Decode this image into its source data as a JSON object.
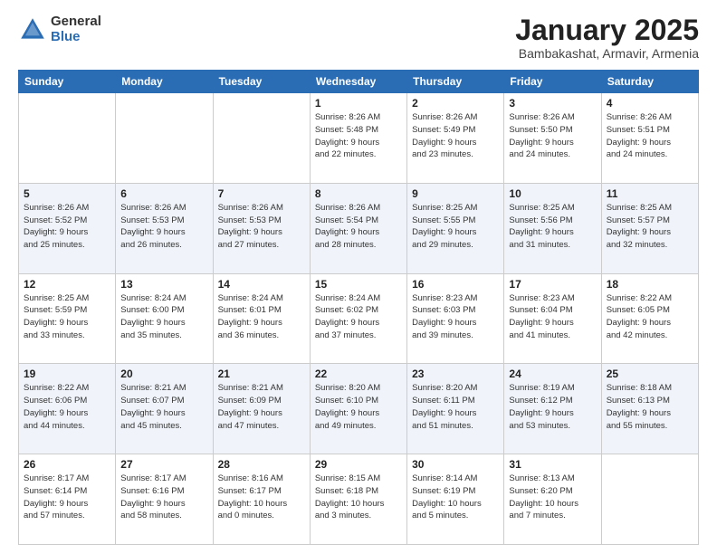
{
  "header": {
    "logo_general": "General",
    "logo_blue": "Blue",
    "month_title": "January 2025",
    "location": "Bambakashat, Armavir, Armenia"
  },
  "days_of_week": [
    "Sunday",
    "Monday",
    "Tuesday",
    "Wednesday",
    "Thursday",
    "Friday",
    "Saturday"
  ],
  "weeks": [
    [
      {
        "day": "",
        "info": ""
      },
      {
        "day": "",
        "info": ""
      },
      {
        "day": "",
        "info": ""
      },
      {
        "day": "1",
        "info": "Sunrise: 8:26 AM\nSunset: 5:48 PM\nDaylight: 9 hours\nand 22 minutes."
      },
      {
        "day": "2",
        "info": "Sunrise: 8:26 AM\nSunset: 5:49 PM\nDaylight: 9 hours\nand 23 minutes."
      },
      {
        "day": "3",
        "info": "Sunrise: 8:26 AM\nSunset: 5:50 PM\nDaylight: 9 hours\nand 24 minutes."
      },
      {
        "day": "4",
        "info": "Sunrise: 8:26 AM\nSunset: 5:51 PM\nDaylight: 9 hours\nand 24 minutes."
      }
    ],
    [
      {
        "day": "5",
        "info": "Sunrise: 8:26 AM\nSunset: 5:52 PM\nDaylight: 9 hours\nand 25 minutes."
      },
      {
        "day": "6",
        "info": "Sunrise: 8:26 AM\nSunset: 5:53 PM\nDaylight: 9 hours\nand 26 minutes."
      },
      {
        "day": "7",
        "info": "Sunrise: 8:26 AM\nSunset: 5:53 PM\nDaylight: 9 hours\nand 27 minutes."
      },
      {
        "day": "8",
        "info": "Sunrise: 8:26 AM\nSunset: 5:54 PM\nDaylight: 9 hours\nand 28 minutes."
      },
      {
        "day": "9",
        "info": "Sunrise: 8:25 AM\nSunset: 5:55 PM\nDaylight: 9 hours\nand 29 minutes."
      },
      {
        "day": "10",
        "info": "Sunrise: 8:25 AM\nSunset: 5:56 PM\nDaylight: 9 hours\nand 31 minutes."
      },
      {
        "day": "11",
        "info": "Sunrise: 8:25 AM\nSunset: 5:57 PM\nDaylight: 9 hours\nand 32 minutes."
      }
    ],
    [
      {
        "day": "12",
        "info": "Sunrise: 8:25 AM\nSunset: 5:59 PM\nDaylight: 9 hours\nand 33 minutes."
      },
      {
        "day": "13",
        "info": "Sunrise: 8:24 AM\nSunset: 6:00 PM\nDaylight: 9 hours\nand 35 minutes."
      },
      {
        "day": "14",
        "info": "Sunrise: 8:24 AM\nSunset: 6:01 PM\nDaylight: 9 hours\nand 36 minutes."
      },
      {
        "day": "15",
        "info": "Sunrise: 8:24 AM\nSunset: 6:02 PM\nDaylight: 9 hours\nand 37 minutes."
      },
      {
        "day": "16",
        "info": "Sunrise: 8:23 AM\nSunset: 6:03 PM\nDaylight: 9 hours\nand 39 minutes."
      },
      {
        "day": "17",
        "info": "Sunrise: 8:23 AM\nSunset: 6:04 PM\nDaylight: 9 hours\nand 41 minutes."
      },
      {
        "day": "18",
        "info": "Sunrise: 8:22 AM\nSunset: 6:05 PM\nDaylight: 9 hours\nand 42 minutes."
      }
    ],
    [
      {
        "day": "19",
        "info": "Sunrise: 8:22 AM\nSunset: 6:06 PM\nDaylight: 9 hours\nand 44 minutes."
      },
      {
        "day": "20",
        "info": "Sunrise: 8:21 AM\nSunset: 6:07 PM\nDaylight: 9 hours\nand 45 minutes."
      },
      {
        "day": "21",
        "info": "Sunrise: 8:21 AM\nSunset: 6:09 PM\nDaylight: 9 hours\nand 47 minutes."
      },
      {
        "day": "22",
        "info": "Sunrise: 8:20 AM\nSunset: 6:10 PM\nDaylight: 9 hours\nand 49 minutes."
      },
      {
        "day": "23",
        "info": "Sunrise: 8:20 AM\nSunset: 6:11 PM\nDaylight: 9 hours\nand 51 minutes."
      },
      {
        "day": "24",
        "info": "Sunrise: 8:19 AM\nSunset: 6:12 PM\nDaylight: 9 hours\nand 53 minutes."
      },
      {
        "day": "25",
        "info": "Sunrise: 8:18 AM\nSunset: 6:13 PM\nDaylight: 9 hours\nand 55 minutes."
      }
    ],
    [
      {
        "day": "26",
        "info": "Sunrise: 8:17 AM\nSunset: 6:14 PM\nDaylight: 9 hours\nand 57 minutes."
      },
      {
        "day": "27",
        "info": "Sunrise: 8:17 AM\nSunset: 6:16 PM\nDaylight: 9 hours\nand 58 minutes."
      },
      {
        "day": "28",
        "info": "Sunrise: 8:16 AM\nSunset: 6:17 PM\nDaylight: 10 hours\nand 0 minutes."
      },
      {
        "day": "29",
        "info": "Sunrise: 8:15 AM\nSunset: 6:18 PM\nDaylight: 10 hours\nand 3 minutes."
      },
      {
        "day": "30",
        "info": "Sunrise: 8:14 AM\nSunset: 6:19 PM\nDaylight: 10 hours\nand 5 minutes."
      },
      {
        "day": "31",
        "info": "Sunrise: 8:13 AM\nSunset: 6:20 PM\nDaylight: 10 hours\nand 7 minutes."
      },
      {
        "day": "",
        "info": ""
      }
    ]
  ]
}
